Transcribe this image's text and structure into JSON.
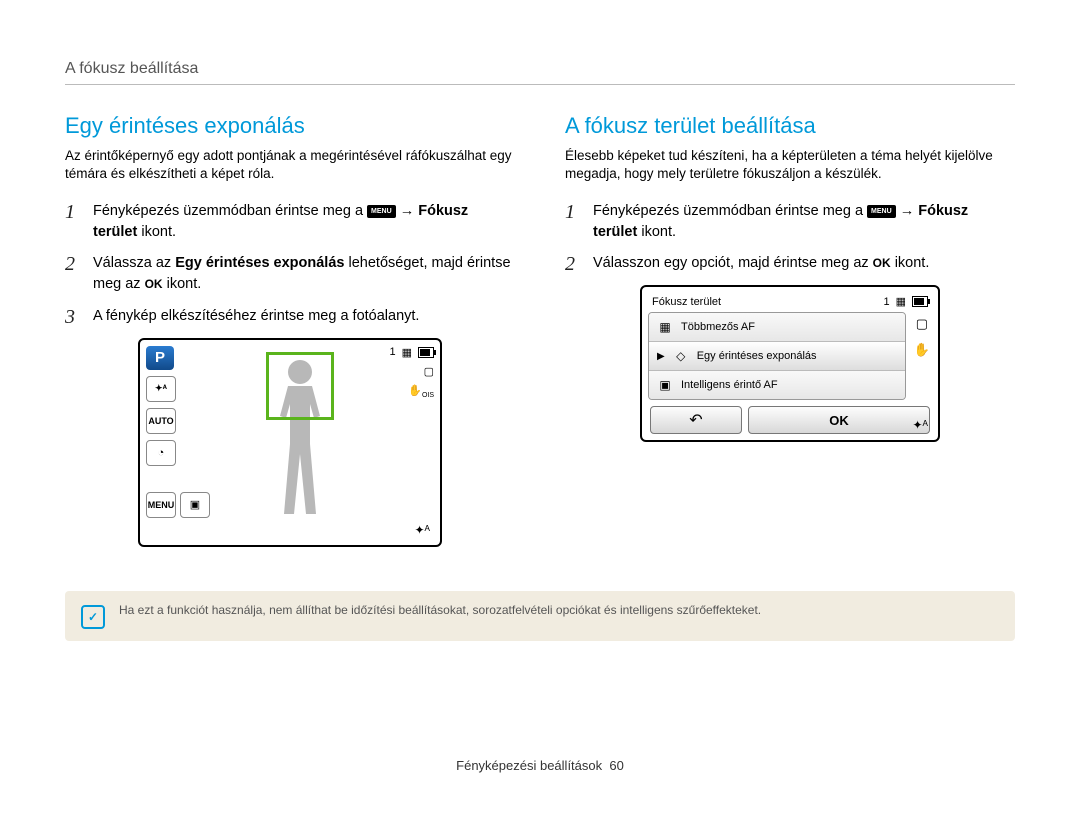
{
  "breadcrumb": "A fókusz beállítása",
  "left": {
    "title": "Egy érintéses exponálás",
    "intro": "Az érintőképernyő egy adott pontjának a megérintésével ráfókuszálhat egy témára és elkészítheti a képet róla.",
    "step1_pre": "Fényképezés üzemmódban érintse meg a ",
    "step1_arrow": " → ",
    "step1_bold": "Fókusz terület",
    "step1_after": " ikont.",
    "step2_pre": "Válassza az ",
    "step2_bold": "Egy érintéses exponálás",
    "step2_mid": " lehetőséget, majd érintse meg az ",
    "step2_after": " ikont.",
    "step3": "A fénykép elkészítéséhez érintse meg a fotóalanyt.",
    "menu_label": "MENU",
    "ok_label": "OK",
    "camera_top_right_counter": "1",
    "camera_bottom_right": "✦ᴬ"
  },
  "right": {
    "title": "A fókusz terület beállítása",
    "intro": "Élesebb képeket tud készíteni, ha a képterületen a téma helyét kijelölve megadja, hogy mely területre fókuszáljon a készülék.",
    "step1_pre": "Fényképezés üzemmódban érintse meg a ",
    "step1_arrow": " → ",
    "step1_bold": "Fókusz terület",
    "step1_after": " ikont.",
    "step2_pre": "Válasszon egy opciót, majd érintse meg az ",
    "step2_after": " ikont.",
    "menu_label": "MENU",
    "ok_label": "OK",
    "panel_title": "Fókusz terület",
    "panel_counter": "1",
    "items": [
      "Többmezős AF",
      "Egy érintéses exponálás",
      "Intelligens érintő AF"
    ],
    "btn_ok": "OK",
    "corner": "✦ᴬ"
  },
  "note": "Ha ezt a funkciót használja, nem állíthat be időzítési beállításokat, sorozatfelvételi opciókat és intelligens szűrőeffekteket.",
  "footer_label": "Fényképezési beállítások",
  "footer_page": "60"
}
